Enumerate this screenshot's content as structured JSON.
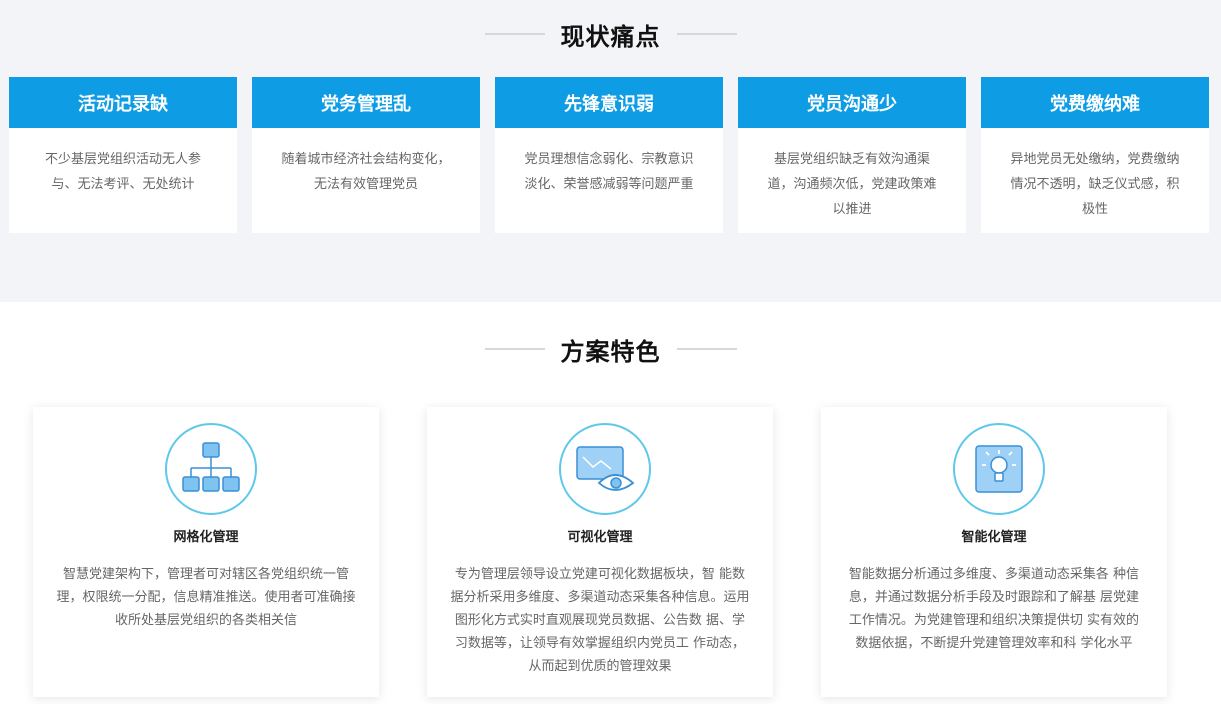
{
  "pain_section": {
    "title": "现状痛点",
    "cards": [
      {
        "title": "活动记录缺",
        "desc": "不少基层党组织活动无人参与、无法考评、无处统计"
      },
      {
        "title": "党务管理乱",
        "desc": "随着城市经济社会结构变化，无法有效管理党员"
      },
      {
        "title": "先锋意识弱",
        "desc": "党员理想信念弱化、宗教意识淡化、荣誉感减弱等问题严重"
      },
      {
        "title": "党员沟通少",
        "desc": "基层党组织缺乏有效沟通渠道，沟通频次低，党建政策难以推进"
      },
      {
        "title": "党费缴纳难",
        "desc": "异地党员无处缴纳，党费缴纳情况不透明，缺乏仪式感，积极性"
      }
    ]
  },
  "feature_section": {
    "title": "方案特色",
    "cards": [
      {
        "icon": "network-hierarchy-icon",
        "title": "网格化管理",
        "desc": "智慧党建架构下，管理者可对辖区各党组织统一管理，权限统一分配，信息精准推送。使用者可准确接收所处基层党组织的各类相关信"
      },
      {
        "icon": "monitor-eye-icon",
        "title": "可视化管理",
        "desc": "专为管理层领导设立党建可视化数据板块，智 能数据分析采用多维度、多渠道动态采集各种信息。运用图形化方式实时直观展现党员数据、公告数 据、学习数据等，让领导有效掌握组织内党员工 作动态，从而起到优质的管理效果"
      },
      {
        "icon": "lightbulb-icon",
        "title": "智能化管理",
        "desc": "智能数据分析通过多维度、多渠道动态采集各 种信息，并通过数据分析手段及时跟踪和了解基 层党建工作情况。为党建管理和组织决策提供切 实有效的数据依据，不断提升党建管理效率和科 学化水平"
      }
    ]
  },
  "colors": {
    "accent": "#0e9de5",
    "icon_stroke": "#5ec7ec",
    "icon_fill": "#7fc3f0"
  }
}
